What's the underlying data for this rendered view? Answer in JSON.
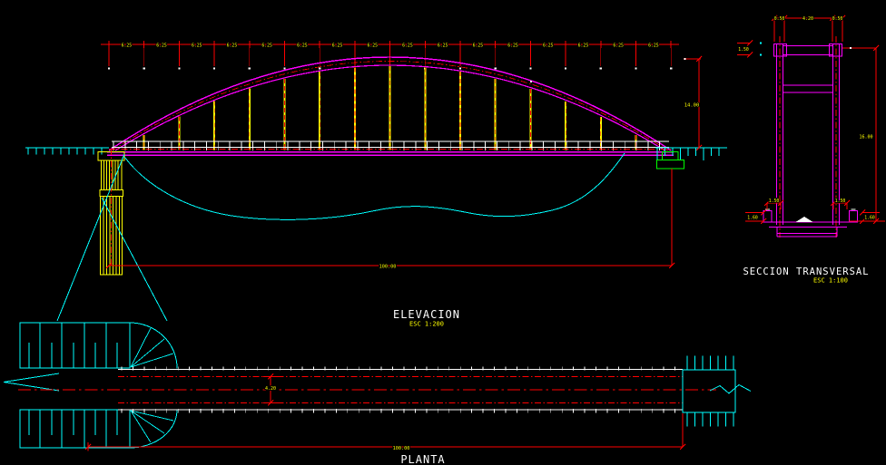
{
  "colors": {
    "background": "#000000",
    "red": "#ff0000",
    "yellow": "#ffff00",
    "magenta": "#ff00ff",
    "cyan": "#00ffff",
    "white": "#ffffff",
    "green": "#00ff00"
  },
  "elevation": {
    "title": "ELEVACION",
    "scale": "ESC 1:200",
    "panel_dim": "6.25",
    "panel_count": 16,
    "span_dim": "100.00",
    "height_dim": "14.00"
  },
  "section": {
    "title": "SECCION TRANSVERSAL",
    "scale": "ESC 1:100",
    "dims": {
      "top_left": "0.50",
      "top_center": "4.20",
      "top_right": "0.50",
      "chord": "1.50",
      "height": "16.00",
      "walk_left": "1.50",
      "walk_right": "1.50",
      "edge_left": "1.60",
      "edge_right": "1.60"
    }
  },
  "plan": {
    "title": "PLANTA",
    "span_dim": "100.00",
    "width_dim": "4.20"
  }
}
